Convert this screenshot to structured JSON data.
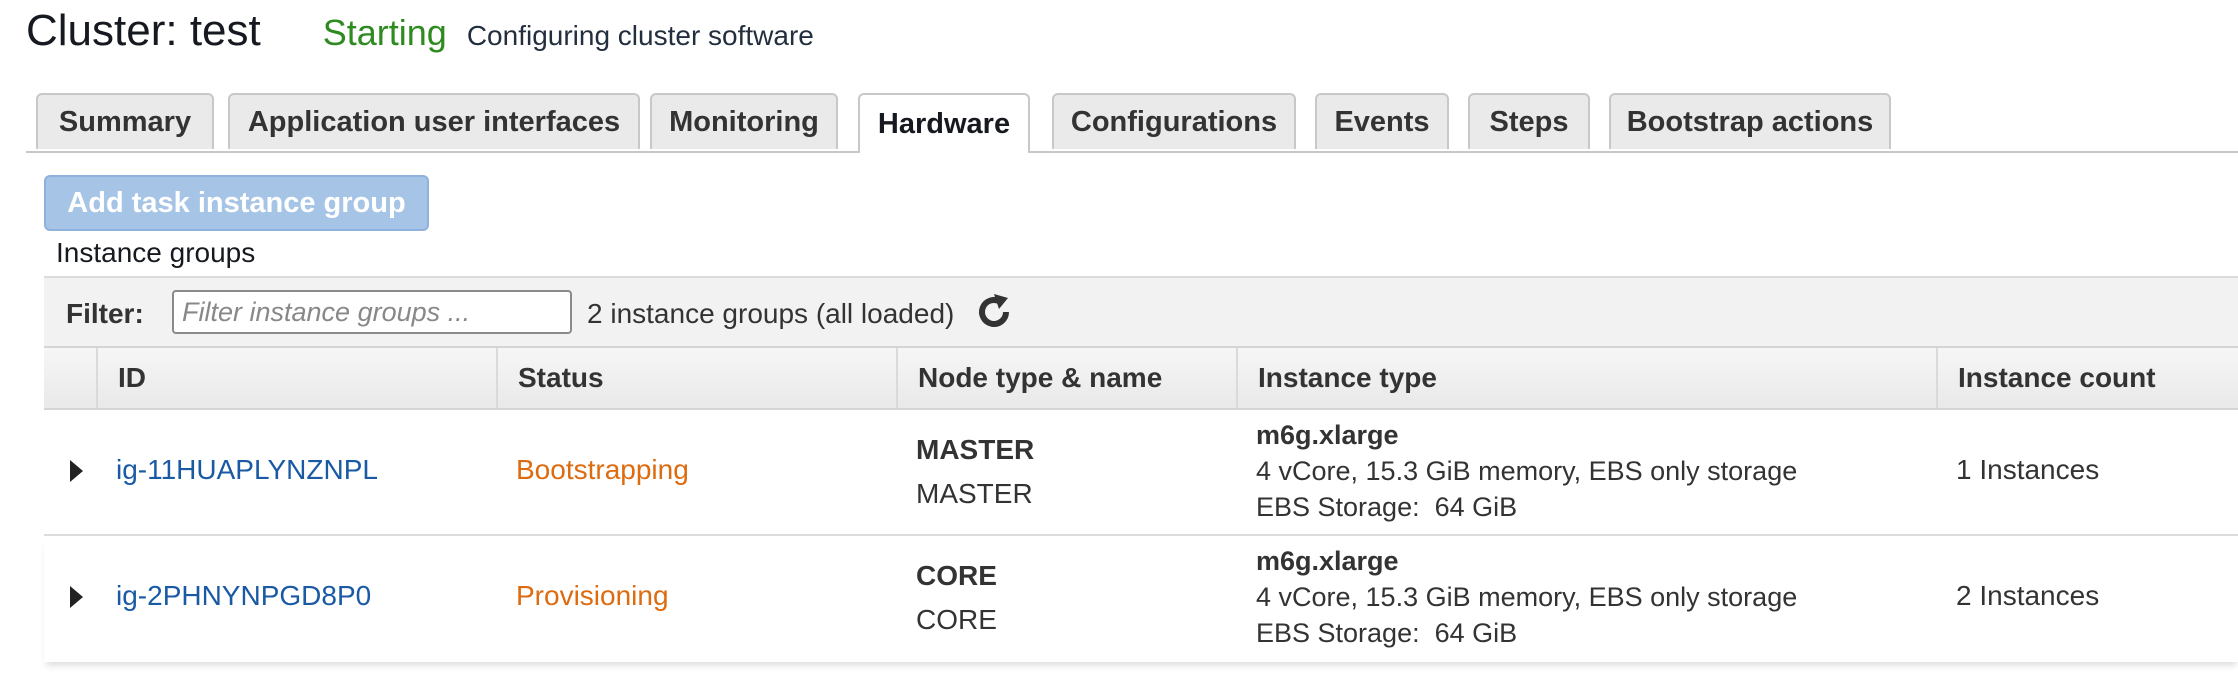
{
  "header": {
    "cluster_title": "Cluster: test",
    "status": "Starting",
    "status_detail": "Configuring cluster software",
    "status_color": "#2e8b20"
  },
  "tabs": [
    {
      "label": "Summary",
      "active": false
    },
    {
      "label": "Application user interfaces",
      "active": false
    },
    {
      "label": "Monitoring",
      "active": false
    },
    {
      "label": "Hardware",
      "active": true
    },
    {
      "label": "Configurations",
      "active": false
    },
    {
      "label": "Events",
      "active": false
    },
    {
      "label": "Steps",
      "active": false
    },
    {
      "label": "Bootstrap actions",
      "active": false
    }
  ],
  "toolbar": {
    "add_task_group_label": "Add task instance group"
  },
  "instance_groups": {
    "section_label": "Instance groups",
    "filter_label": "Filter:",
    "filter_placeholder": "Filter instance groups ...",
    "filter_value": "",
    "count_text": "2 instance groups (all loaded)",
    "refresh_icon": "refresh-icon",
    "columns": [
      "ID",
      "Status",
      "Node type & name",
      "Instance type",
      "Instance count"
    ],
    "rows": [
      {
        "id": "ig-11HUAPLYNZNPL",
        "status": "Bootstrapping",
        "node_type": "MASTER",
        "node_name": "MASTER",
        "instance_type": "m6g.xlarge",
        "instance_desc": "4 vCore, 15.3 GiB memory, EBS only storage",
        "ebs_storage": "EBS Storage:  64 GiB",
        "instance_count": "1 Instances"
      },
      {
        "id": "ig-2PHNYNPGD8P0",
        "status": "Provisioning",
        "node_type": "CORE",
        "node_name": "CORE",
        "instance_type": "m6g.xlarge",
        "instance_desc": "4 vCore, 15.3 GiB memory, EBS only storage",
        "ebs_storage": "EBS Storage:  64 GiB",
        "instance_count": "2 Instances"
      }
    ]
  },
  "colors": {
    "link": "#1a5aa5",
    "status_warning": "#dd6b10",
    "button_disabled": "#a6c4e6"
  }
}
